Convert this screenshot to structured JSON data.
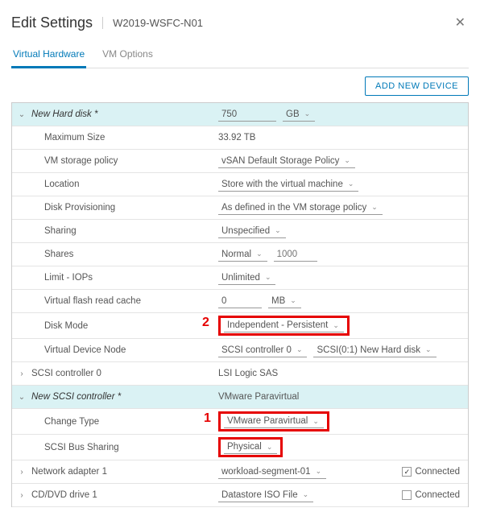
{
  "header": {
    "title": "Edit Settings",
    "subtitle": "W2019-WSFC-N01",
    "close": "✕"
  },
  "tabs": {
    "hardware": "Virtual Hardware",
    "options": "VM Options"
  },
  "toolbar": {
    "add": "ADD NEW DEVICE"
  },
  "annotations": {
    "one": "1",
    "two": "2"
  },
  "rows": {
    "newDisk": {
      "label": "New Hard disk *",
      "size": "750",
      "unit": "GB"
    },
    "maxSize": {
      "label": "Maximum Size",
      "value": "33.92 TB"
    },
    "storagePolicy": {
      "label": "VM storage policy",
      "value": "vSAN Default Storage Policy"
    },
    "location": {
      "label": "Location",
      "value": "Store with the virtual machine"
    },
    "provisioning": {
      "label": "Disk Provisioning",
      "value": "As defined in the VM storage policy"
    },
    "sharing": {
      "label": "Sharing",
      "value": "Unspecified"
    },
    "shares": {
      "label": "Shares",
      "level": "Normal",
      "value": "1000"
    },
    "limit": {
      "label": "Limit - IOPs",
      "value": "Unlimited"
    },
    "flash": {
      "label": "Virtual flash read cache",
      "value": "0",
      "unit": "MB"
    },
    "diskMode": {
      "label": "Disk Mode",
      "value": "Independent - Persistent"
    },
    "vdn": {
      "label": "Virtual Device Node",
      "controller": "SCSI controller 0",
      "slot": "SCSI(0:1) New Hard disk"
    },
    "scsi0": {
      "label": "SCSI controller 0",
      "value": "LSI Logic SAS"
    },
    "newScsi": {
      "label": "New SCSI controller *",
      "value": "VMware Paravirtual"
    },
    "changeType": {
      "label": "Change Type",
      "value": "VMware Paravirtual"
    },
    "busSharing": {
      "label": "SCSI Bus Sharing",
      "value": "Physical"
    },
    "net1": {
      "label": "Network adapter 1",
      "value": "workload-segment-01",
      "connected": "Connected"
    },
    "cd1": {
      "label": "CD/DVD drive 1",
      "value": "Datastore ISO File",
      "connected": "Connected"
    }
  }
}
